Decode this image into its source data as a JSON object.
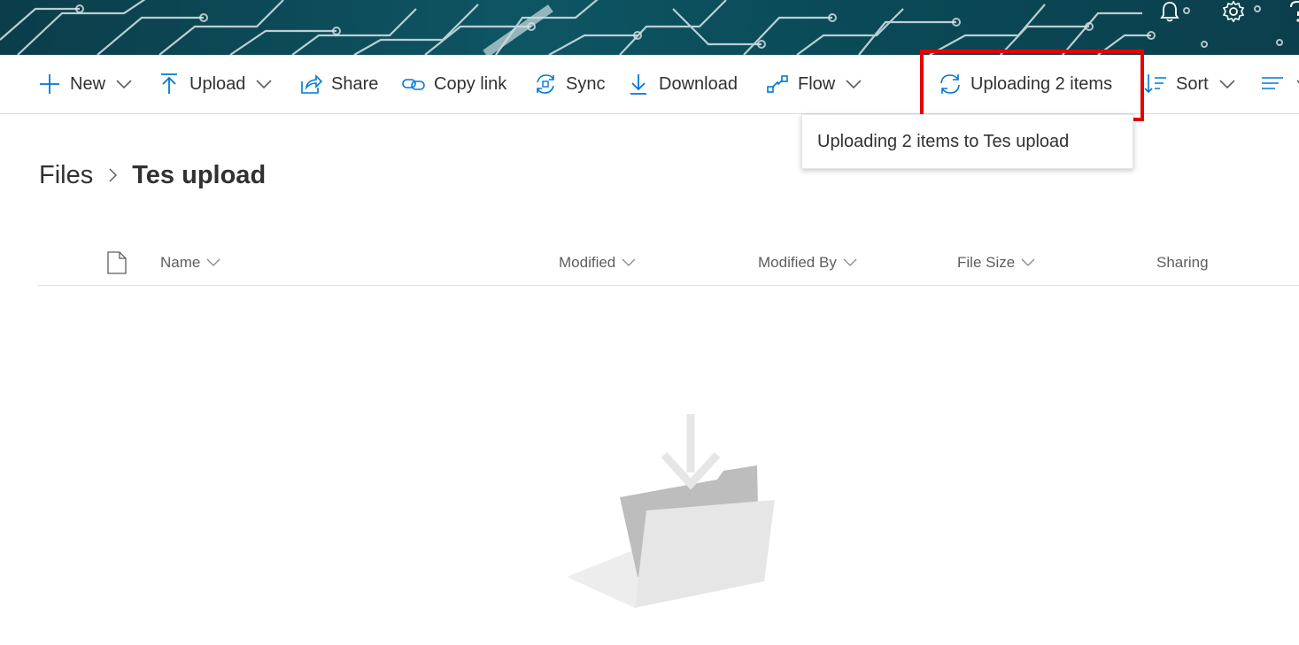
{
  "header": {
    "notifications_icon": "bell-icon",
    "settings_icon": "gear-icon",
    "help_icon": "question-icon",
    "banner_colors": {
      "base": "#0b3d4a",
      "trace": "#d9e6ea"
    }
  },
  "toolbar": {
    "new_label": "New",
    "upload_label": "Upload",
    "share_label": "Share",
    "copy_link_label": "Copy link",
    "sync_label": "Sync",
    "download_label": "Download",
    "flow_label": "Flow",
    "uploading_label": "Uploading 2 items",
    "sort_label": "Sort",
    "accent_color": "#0078d4",
    "highlight_color": "#e60000"
  },
  "tooltip": {
    "text": "Uploading 2 items to Tes upload"
  },
  "breadcrumb": {
    "root": "Files",
    "current": "Tes upload"
  },
  "columns": {
    "type_icon": "document-icon",
    "name": "Name",
    "modified": "Modified",
    "modified_by": "Modified By",
    "file_size": "File Size",
    "sharing": "Sharing"
  },
  "empty_state": {
    "illustration": "folder-download-icon"
  }
}
